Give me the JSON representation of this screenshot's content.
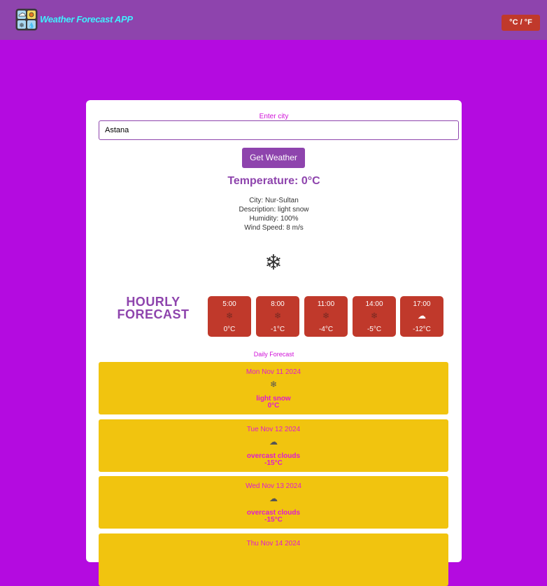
{
  "header": {
    "title": "Weather Forecast APP",
    "unit_toggle": "°C / °F"
  },
  "search": {
    "label": "Enter city",
    "value": "Astana",
    "button": "Get Weather"
  },
  "current": {
    "temperature": "Temperature: 0°C",
    "city": "City: Nur-Sultan",
    "description": "Description: light snow",
    "humidity": "Humidity: 100%",
    "wind": "Wind Speed: 8 m/s",
    "icon": "❄"
  },
  "hourly": {
    "title_line1": "HOURLY",
    "title_line2": "FORECAST",
    "items": [
      {
        "time": "5:00",
        "icon": "❄",
        "icon_name": "snowflake-icon",
        "temp": "0°C"
      },
      {
        "time": "8:00",
        "icon": "❄",
        "icon_name": "snowflake-icon",
        "temp": "-1°C"
      },
      {
        "time": "11:00",
        "icon": "❄",
        "icon_name": "snowflake-icon",
        "temp": "-4°C"
      },
      {
        "time": "14:00",
        "icon": "❄",
        "icon_name": "snowflake-icon",
        "temp": "-5°C"
      },
      {
        "time": "17:00",
        "icon": "☁",
        "icon_name": "cloud-icon",
        "temp": "-12°C"
      }
    ]
  },
  "daily": {
    "label": "Daily Forecast",
    "items": [
      {
        "date": "Mon Nov 11 2024",
        "icon": "❄",
        "icon_name": "snowflake-icon",
        "desc": "light snow",
        "temp": "0°C"
      },
      {
        "date": "Tue Nov 12 2024",
        "icon": "☁",
        "icon_name": "cloud-icon",
        "desc": "overcast clouds",
        "temp": "-15°C"
      },
      {
        "date": "Wed Nov 13 2024",
        "icon": "☁",
        "icon_name": "cloud-icon",
        "desc": "overcast clouds",
        "temp": "-15°C"
      },
      {
        "date": "Thu Nov 14 2024",
        "icon": "",
        "icon_name": "",
        "desc": "",
        "temp": ""
      }
    ]
  },
  "colors": {
    "background": "#b40be0",
    "header": "#8e44ad",
    "title": "#3ff0ff",
    "accent_red": "#c0392b",
    "daily_card": "#f1c40f",
    "daily_text": "#e01ad0"
  }
}
